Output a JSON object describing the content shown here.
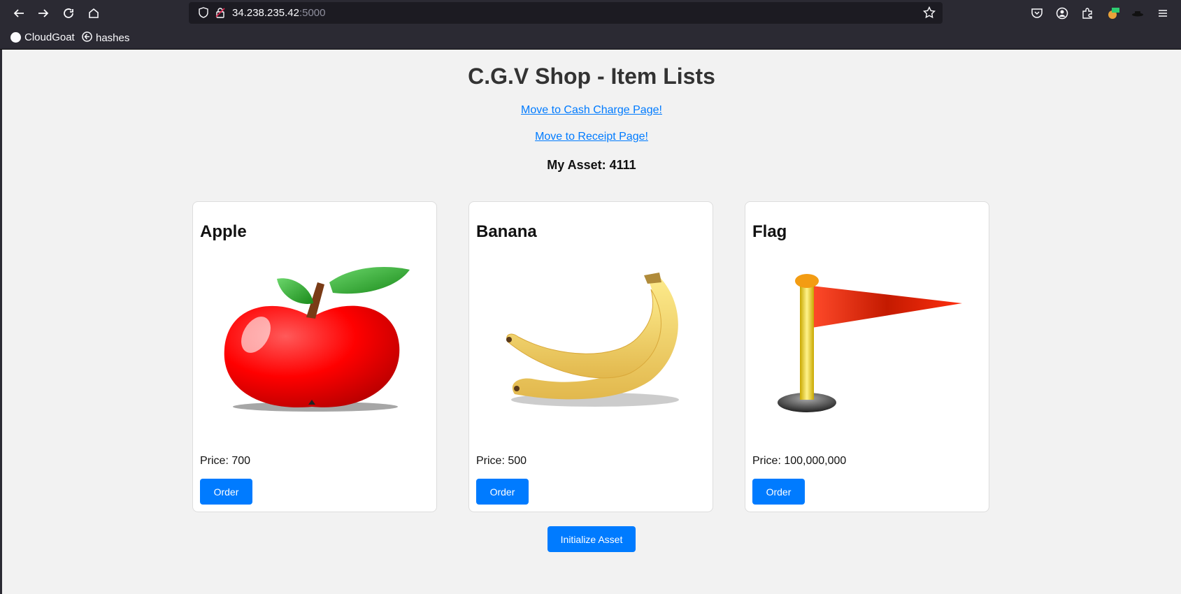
{
  "browser": {
    "url_host": "34.238.235.42",
    "url_port": ":5000",
    "bookmarks": [
      {
        "label": "CloudGoat"
      },
      {
        "label": "hashes"
      }
    ]
  },
  "page": {
    "title": "C.G.V Shop - Item Lists",
    "cash_link": "Move to Cash Charge Page!",
    "receipt_link": "Move to Receipt Page!",
    "asset_text": "My Asset: 4111",
    "items": [
      {
        "name": "Apple",
        "price": "Price: 700",
        "order_label": "Order"
      },
      {
        "name": "Banana",
        "price": "Price: 500",
        "order_label": "Order"
      },
      {
        "name": "Flag",
        "price": "Price: 100,000,000",
        "order_label": "Order"
      }
    ],
    "init_label": "Initialize Asset"
  },
  "colors": {
    "accent": "#007bff",
    "page_bg": "#f2f2f2",
    "chrome_bg": "#2b2a33"
  }
}
